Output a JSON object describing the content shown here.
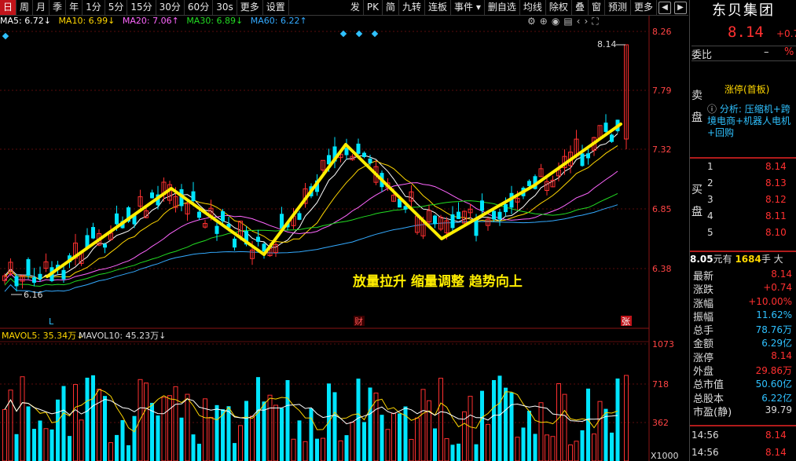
{
  "toolbar": {
    "items": [
      "日",
      "周",
      "月",
      "季",
      "年",
      "1分",
      "5分",
      "15分",
      "30分",
      "60分",
      "30s",
      "更多",
      "设置"
    ],
    "right_items": [
      "发",
      "PK",
      "简",
      "九转",
      "连板",
      "事件"
    ],
    "right_items2": [
      "删自选",
      "均线",
      "除权",
      "叠",
      "窗",
      "预测",
      "更多"
    ]
  },
  "ma": {
    "ma5": "MA5: 6.72↓",
    "ma10": "MA10: 6.99↓",
    "ma20": "MA20: 7.06↑",
    "ma30": "MA30: 6.89↓",
    "ma60": "MA60: 6.22↑",
    "ma5_color": "#ffffff",
    "ma10_color": "#ffd700",
    "ma20_color": "#ff66ff",
    "ma30_color": "#22dd22",
    "ma60_color": "#33aaff"
  },
  "vol_header": {
    "mavol5": "MAVOL5: 35.34万↓",
    "mavol10": "MAVOL10: 45.23万↓"
  },
  "axis": {
    "price_ticks": [
      "8.26",
      "7.79",
      "7.32",
      "6.85",
      "6.38"
    ],
    "vol_ticks": [
      "1073",
      "718",
      "362"
    ],
    "vol_unit": "X1000"
  },
  "annotations": {
    "caption": "放量拉升 缩量调整 趋势向上",
    "high_label": "8.14",
    "low_label": "6.16",
    "marker_l": "L",
    "marker_cai": "财",
    "marker_zhang": "张"
  },
  "panel": {
    "stock_name": "东贝集团",
    "price": "8.14",
    "change": "+0.7",
    "weibi_label": "委比",
    "weibi_value": "–",
    "weibi_value2": "%",
    "sell_label": "卖盘",
    "buy_label": "买盘",
    "limit_status": "涨停(首板)",
    "analysis_icon": "ⓘ",
    "analysis": "分析: 压缩机+跨境电商+机器人电机+回购",
    "bids": [
      {
        "n": "1",
        "p": "8.14"
      },
      {
        "n": "2",
        "p": "8.13"
      },
      {
        "n": "3",
        "p": "8.12"
      },
      {
        "n": "4",
        "p": "8.11"
      },
      {
        "n": "5",
        "p": "8.10"
      }
    ],
    "tline_price": "8.05",
    "tline_mid": "元有",
    "tline_qty": "1684",
    "tline_unit": "手 大",
    "stats": [
      {
        "k": "最新",
        "v": "8.14",
        "c": "#ff3030"
      },
      {
        "k": "涨跌",
        "v": "+0.74",
        "c": "#ff3030"
      },
      {
        "k": "涨幅",
        "v": "+10.00%",
        "c": "#ff3030"
      },
      {
        "k": "振幅",
        "v": "11.62%",
        "c": "#2fc1ff"
      },
      {
        "k": "总手",
        "v": "78.76万",
        "c": "#2fc1ff"
      },
      {
        "k": "金额",
        "v": "6.29亿",
        "c": "#2fc1ff"
      },
      {
        "k": "涨停",
        "v": "8.14",
        "c": "#ff3030"
      },
      {
        "k": "外盘",
        "v": "29.86万",
        "c": "#ff3030"
      },
      {
        "k": "总市值",
        "v": "50.60亿",
        "c": "#2fc1ff"
      },
      {
        "k": "总股本",
        "v": "6.22亿",
        "c": "#2fc1ff"
      },
      {
        "k": "市盈(静)",
        "v": "39.79",
        "c": "#dddddd"
      }
    ],
    "ticks": [
      {
        "t": "14:56",
        "p": "8.14"
      },
      {
        "t": "14:56",
        "p": "8.14"
      }
    ]
  },
  "colors": {
    "up": "#ff3030",
    "down": "#00e5ff",
    "trend": "#ffee00",
    "grid": "#7a1010"
  }
}
